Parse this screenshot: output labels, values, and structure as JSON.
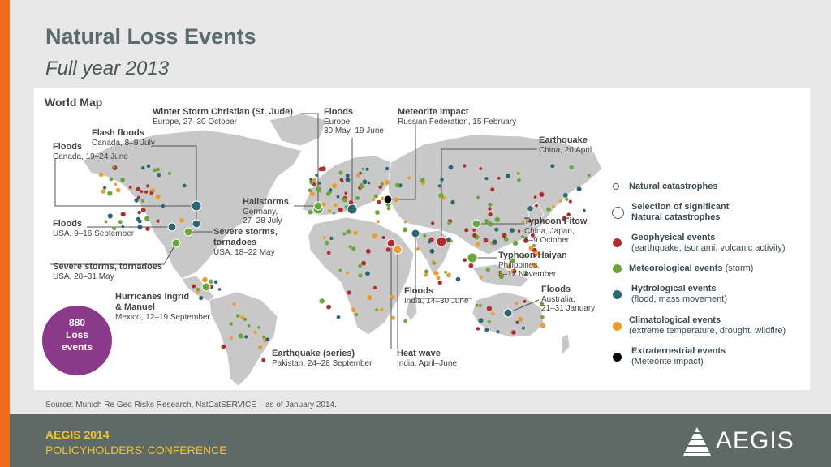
{
  "header": {
    "title": "Natural Loss Events",
    "subtitle": "Full year 2013"
  },
  "panel": {
    "title": "World Map"
  },
  "events": [
    {
      "title": "Winter Storm Christian (St. Jude)",
      "lines": [
        "Europe, 27–30 October"
      ]
    },
    {
      "title": "Floods",
      "lines": [
        "Europe,",
        "30 May–19 June"
      ]
    },
    {
      "title": "Meteorite impact",
      "lines": [
        "Russian Federation, 15 February"
      ]
    },
    {
      "title": "Flash floods",
      "lines": [
        "Canada, 8–9 July"
      ]
    },
    {
      "title": "Floods",
      "lines": [
        "Canada, 19–24 June"
      ]
    },
    {
      "title": "Earthquake",
      "lines": [
        "China, 20 April"
      ]
    },
    {
      "title": "Hailstorms",
      "lines": [
        "Germany,",
        "27–28 July"
      ]
    },
    {
      "title": "Floods",
      "lines": [
        "USA, 9–16 September"
      ]
    },
    {
      "title": "Severe storms,",
      "lines": []
    },
    {
      "title": "tornadoes",
      "lines": [
        "USA, 18–22 May"
      ]
    },
    {
      "title": "Typhoon Fitow",
      "lines": [
        "China, Japan,",
        "5–9 October"
      ]
    },
    {
      "title": "Typhoon Haiyan",
      "lines": [
        "Philippines,",
        "8–12 November"
      ]
    },
    {
      "title": "Severe storms, tornadoes",
      "lines": [
        "USA, 28–31 May"
      ]
    },
    {
      "title": "Hurricanes Ingrid",
      "lines": []
    },
    {
      "title": "& Manuel",
      "lines": [
        "Mexico, 12–19 September"
      ]
    },
    {
      "title": "Floods",
      "lines": [
        "India, 14–30 June"
      ]
    },
    {
      "title": "Floods",
      "lines": [
        "Australia,",
        "21–31 January"
      ]
    },
    {
      "title": "Earthquake (series)",
      "lines": [
        "Pakistan, 24–28 September"
      ]
    },
    {
      "title": "Heat wave",
      "lines": [
        "India, April–June"
      ]
    }
  ],
  "badge": {
    "count": "880",
    "line2": "Loss",
    "line3": "events"
  },
  "legend": {
    "natural": "Natural catastrophes",
    "selection_1": "Selection of significant",
    "selection_2": "Natural catastrophes",
    "geo_title": "Geophysical events",
    "geo_desc": "(earthquake, tsunami, volcanic activity)",
    "met_title": "Meteorological events",
    "met_desc": "(storm)",
    "hyd_title": "Hydrological events",
    "hyd_desc": "(flood, mass movement)",
    "cli_title": "Climatological events",
    "cli_desc": "(extreme temperature, drought, wildfire)",
    "ext_title": "Extraterrestrial events",
    "ext_desc": "(Meteorite impact)"
  },
  "colors": {
    "geophysical": "#b22c2c",
    "meteorological": "#6aa63a",
    "hydrological": "#2b6673",
    "climatological": "#f09a2a",
    "extraterrestrial": "#000000",
    "land": "#c8c8c8",
    "accent": "#f26a1b",
    "badge": "#8b3a8b"
  },
  "source": "Source: Munich Re Geo Risks Research, NatCatSERVICE – as of January 2014.",
  "footer": {
    "line1": "AEGIS 2014",
    "line2": "POLICYHOLDERS' CONFERENCE",
    "logo": "AEGIS"
  }
}
